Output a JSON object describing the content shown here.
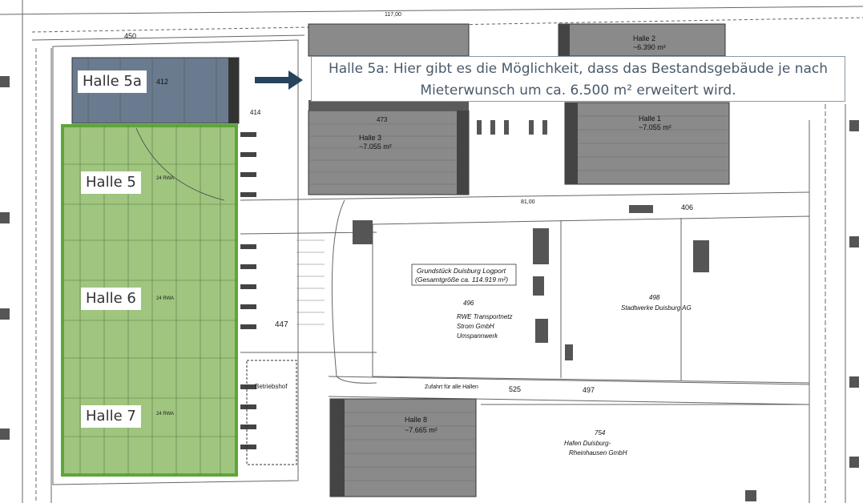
{
  "labels": {
    "halle5a": "Halle 5a",
    "halle5": "Halle 5",
    "halle6": "Halle 6",
    "halle7": "Halle 7"
  },
  "callout": {
    "line1": "Halle 5a: Hier gibt es die Möglichkeit, dass das Bestandsgebäude je nach",
    "line2": "Mieterwunsch um ca. 6.500 m² erweitert wird."
  },
  "plan_text": {
    "halle2_name": "Halle 2",
    "halle2_area": "~6.390 m²",
    "halle1_name": "Halle 1",
    "halle1_area": "~7.055 m²",
    "halle3_name": "Halle 3",
    "halle3_area": "~7.055 m²",
    "halle8_name": "Halle 8",
    "halle8_area": "~7.665 m²",
    "plot_title": "Grundstück Duisburg Logport",
    "plot_total": "(Gesamtgröße ca. 114.919 m²)",
    "parcel_496": "496",
    "rwe_1": "RWE Transportnetz",
    "rwe_2": "Strom GmbH",
    "rwe_3": "Umspannwerk",
    "parcel_498": "498",
    "stadtwerke": "Stadtwerke Duisburg AG",
    "parcel_754": "754",
    "hafen_1": "Hafen Duisburg-",
    "hafen_2": "Rheinhausen GmbH",
    "parcel_447": "447",
    "parcel_525": "525",
    "parcel_497": "497",
    "parcel_406": "406",
    "parcel_450": "450",
    "parcel_412": "412",
    "parcel_414": "414",
    "parcel_473": "473",
    "zufahrt": "Zufahrt für alle Hallen",
    "betriebshof": "Betriebshof",
    "dim_11700": "117,00",
    "dim_8100": "81,00",
    "rwa_1": "24 RWA",
    "rwa_2": "24 RWA",
    "rwa_3": "24 RWA"
  },
  "colors": {
    "green_fill": "#9fc57f",
    "green_border": "#5ea53a",
    "hall_dark": "#7d7d7d",
    "hall_5a": "#6a7b8f",
    "arrow": "#28435e",
    "line": "#555555"
  }
}
